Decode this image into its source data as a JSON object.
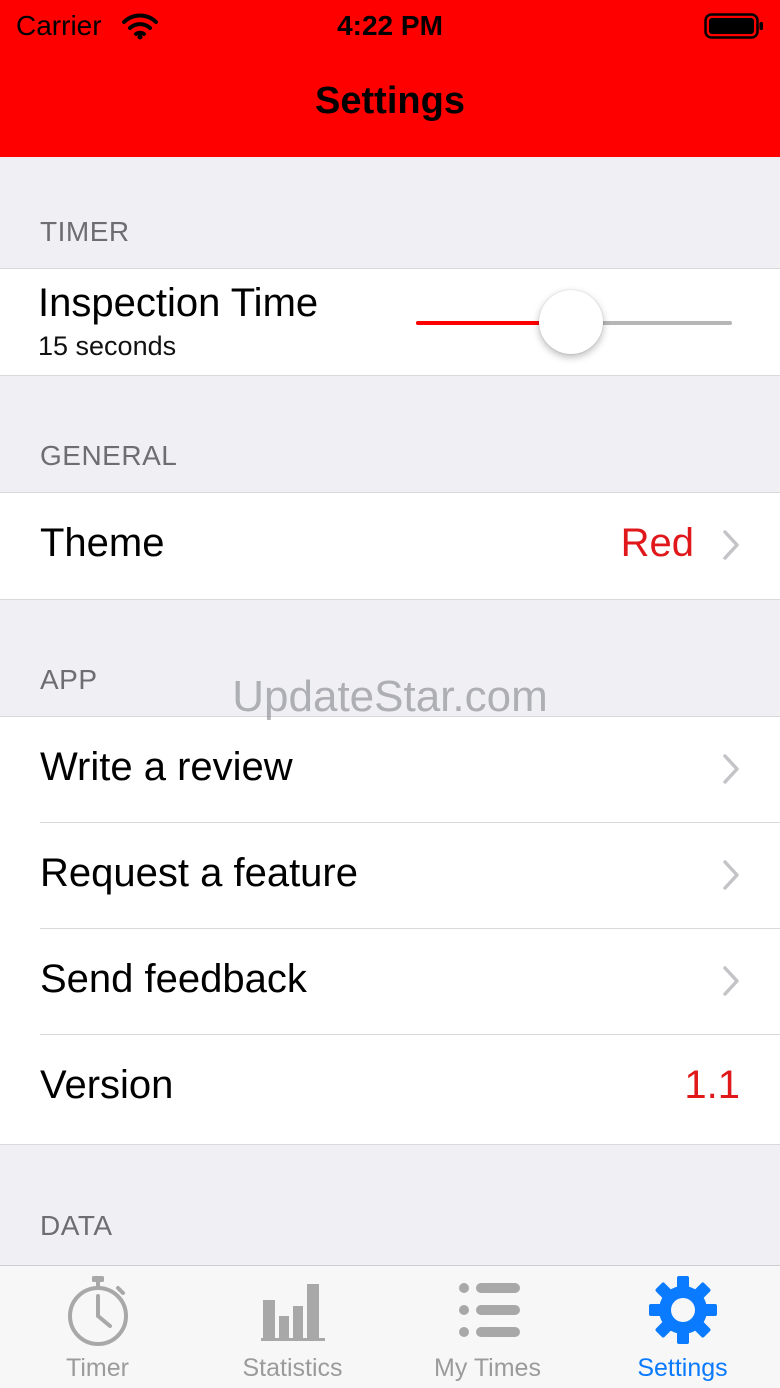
{
  "status_bar": {
    "carrier": "Carrier",
    "time": "4:22 PM"
  },
  "nav": {
    "title": "Settings"
  },
  "colors": {
    "theme": "#ff0000",
    "accent_text": "#e0181b",
    "tab_active": "#0a7aff",
    "tab_inactive": "#9b9b9b"
  },
  "sections": {
    "timer": {
      "header": "TIMER",
      "inspection": {
        "title": "Inspection Time",
        "subtitle": "15 seconds",
        "slider_fraction": 0.49
      }
    },
    "general": {
      "header": "GENERAL",
      "theme": {
        "label": "Theme",
        "value": "Red"
      }
    },
    "app": {
      "header": "APP",
      "items": [
        {
          "label": "Write a review"
        },
        {
          "label": "Request a feature"
        },
        {
          "label": "Send feedback"
        },
        {
          "label": "Version",
          "value": "1.1"
        }
      ]
    },
    "data": {
      "header": "DATA"
    }
  },
  "watermark": "UpdateStar.com",
  "tabs": [
    {
      "label": "Timer",
      "icon": "stopwatch-icon"
    },
    {
      "label": "Statistics",
      "icon": "bar-chart-icon"
    },
    {
      "label": "My Times",
      "icon": "list-icon"
    },
    {
      "label": "Settings",
      "icon": "gear-icon",
      "active": true
    }
  ]
}
